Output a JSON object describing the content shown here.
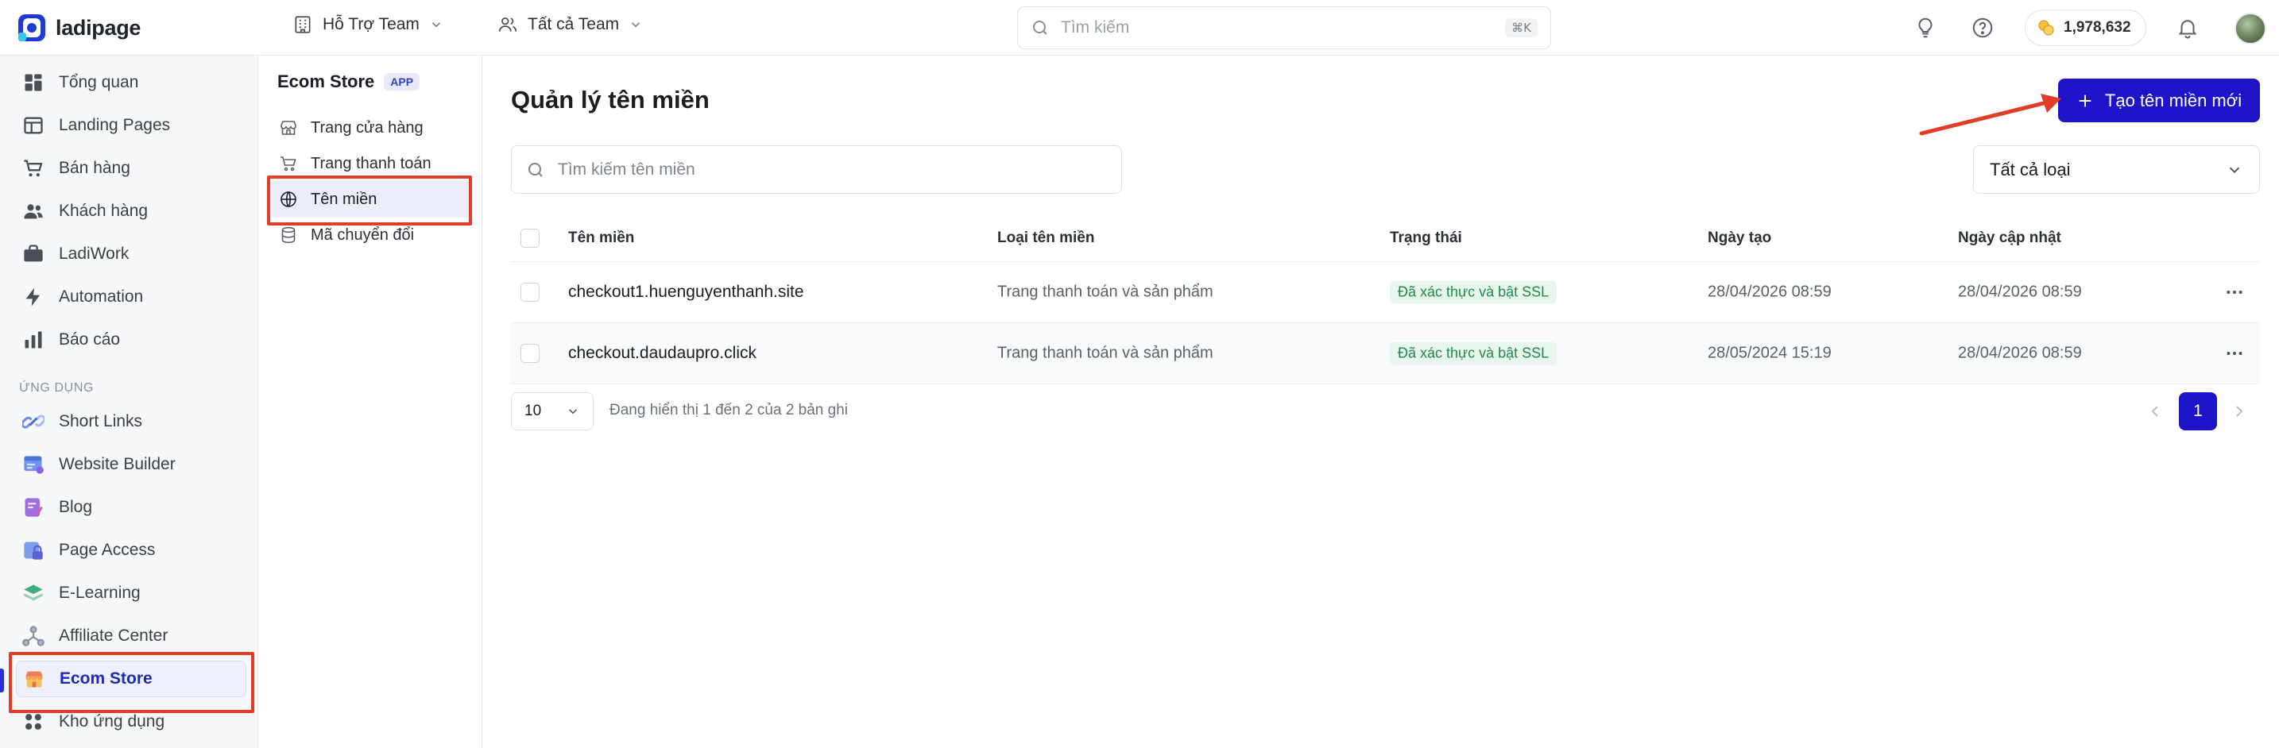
{
  "topbar": {
    "logo_text": "ladipage",
    "team_1": "Hỗ Trợ Team",
    "team_2": "Tất cả Team",
    "search_placeholder": "Tìm kiếm",
    "search_shortcut": "⌘K",
    "credit": "1,978,632"
  },
  "sidebar": {
    "items": [
      {
        "label": "Tổng quan",
        "icon": "grid-icon"
      },
      {
        "label": "Landing Pages",
        "icon": "layout-icon"
      },
      {
        "label": "Bán hàng",
        "icon": "cart-icon"
      },
      {
        "label": "Khách hàng",
        "icon": "users-icon"
      },
      {
        "label": "LadiWork",
        "icon": "briefcase-icon"
      },
      {
        "label": "Automation",
        "icon": "lightning-icon"
      },
      {
        "label": "Báo cáo",
        "icon": "bar-chart-icon"
      }
    ],
    "section_label": "ỨNG DỤNG",
    "apps": [
      {
        "label": "Short Links",
        "icon": "link-icon"
      },
      {
        "label": "Website Builder",
        "icon": "website-icon"
      },
      {
        "label": "Blog",
        "icon": "blog-icon"
      },
      {
        "label": "Page Access",
        "icon": "lock-icon"
      },
      {
        "label": "E-Learning",
        "icon": "book-icon"
      },
      {
        "label": "Affiliate Center",
        "icon": "network-icon"
      },
      {
        "label": "Ecom Store",
        "icon": "store-icon"
      },
      {
        "label": "Kho ứng dụng",
        "icon": "apps-icon"
      }
    ]
  },
  "subsidebar": {
    "title": "Ecom Store",
    "badge": "APP",
    "items": [
      {
        "label": "Trang cửa hàng",
        "icon": "shop-icon"
      },
      {
        "label": "Trang thanh toán",
        "icon": "checkout-cart-icon"
      },
      {
        "label": "Tên miền",
        "icon": "globe-icon"
      },
      {
        "label": "Mã chuyển đổi",
        "icon": "database-icon"
      }
    ]
  },
  "main": {
    "title": "Quản lý tên miền",
    "create_button": "Tạo tên miền mới",
    "search_placeholder": "Tìm kiếm tên miền",
    "type_filter": "Tất cả loại",
    "columns": [
      "Tên miền",
      "Loại tên miền",
      "Trạng thái",
      "Ngày tạo",
      "Ngày cập nhật"
    ],
    "rows": [
      {
        "domain": "checkout1.huenguyenthanh.site",
        "type": "Trang thanh toán và sản phẩm",
        "status": "Đã xác thực và bật SSL",
        "created": "28/04/2026 08:59",
        "updated": "28/04/2026 08:59"
      },
      {
        "domain": "checkout.daudaupro.click",
        "type": "Trang thanh toán và sản phẩm",
        "status": "Đã xác thực và bật SSL",
        "created": "28/05/2024 15:19",
        "updated": "28/04/2026 08:59"
      }
    ],
    "page_size": "10",
    "pager_info": "Đang hiển thị 1 đến 2 của 2 bản ghi",
    "current_page": "1"
  },
  "colors": {
    "accent": "#1d14c9",
    "annotation": "#e23d28",
    "status_green": "#1e8a4c"
  }
}
